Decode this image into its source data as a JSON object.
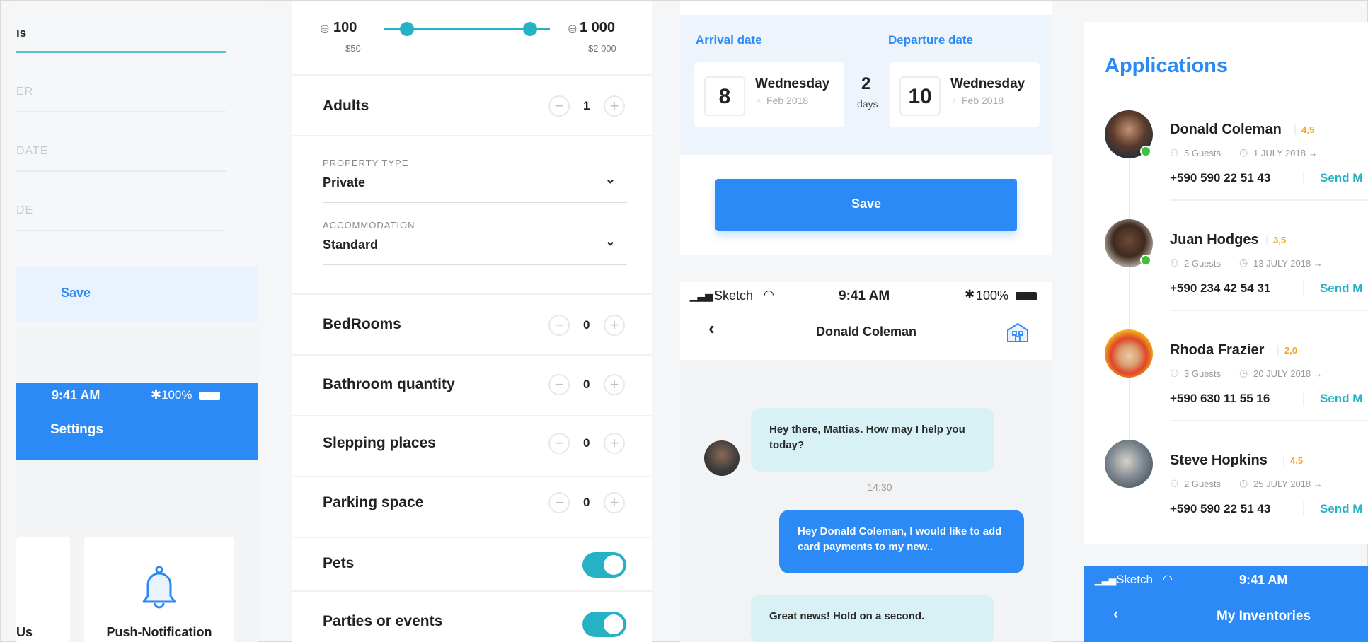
{
  "colors": {
    "accent": "#2b8af5",
    "teal": "#26b1c4",
    "online": "#3bc13b",
    "rating": "#f5a623"
  },
  "left": {
    "top_field_value": "ıs",
    "placeholders": [
      "ER",
      "DATE",
      "DE"
    ],
    "save_label": "Save",
    "status_time": "9:41 AM",
    "status_battery": "100%",
    "header_title": "Settings",
    "tile1_label": "Us",
    "tile2_label": "Push-Notification"
  },
  "filters": {
    "price_min": "100",
    "price_max": "1 000",
    "price_min_sub": "$50",
    "price_max_sub": "$2 000",
    "adults": {
      "label": "Adults",
      "value": "1"
    },
    "property_type": {
      "label": "PROPERTY TYPE",
      "value": "Private"
    },
    "accommodation": {
      "label": "ACCOMMODATION",
      "value": "Standard"
    },
    "counters": [
      {
        "label": "BedRooms",
        "value": "0"
      },
      {
        "label": "Bathroom quantity",
        "value": "0"
      },
      {
        "label": "Slepping places",
        "value": "0"
      },
      {
        "label": "Parking space",
        "value": "0"
      }
    ],
    "toggles": [
      {
        "label": "Pets",
        "on": true
      },
      {
        "label": "Parties or events",
        "on": true
      }
    ]
  },
  "booking": {
    "arrival_label": "Arrival date",
    "departure_label": "Departure date",
    "arrival_day": "8",
    "arrival_weekday": "Wednesday",
    "arrival_month": "Feb 2018",
    "nights": "2",
    "nights_label": "days",
    "departure_day": "10",
    "departure_weekday": "Wednesday",
    "departure_month": "Feb 2018",
    "save_label": "Save"
  },
  "chat": {
    "carrier": "Sketch",
    "time": "9:41 AM",
    "battery": "100%",
    "back": "‹",
    "title": "Donald Coleman",
    "messages": [
      {
        "text": "Hey there, Mattias. How may I help you today?",
        "side": "in"
      },
      {
        "text": "Hey Donald Coleman, I would like to add card payments to my new..",
        "side": "out"
      },
      {
        "text": "Great news! Hold on a second.",
        "side": "in"
      }
    ],
    "timestamp": "14:30"
  },
  "applications": {
    "title": "Applications",
    "items": [
      {
        "name": "Donald Coleman",
        "rating": "4,5",
        "guests": "5 Guests",
        "date": "1 JULY 2018 →",
        "phone": "+590 590 22 51 43",
        "action": "Send M",
        "online": true
      },
      {
        "name": "Juan Hodges",
        "rating": "3,5",
        "guests": "2 Guests",
        "date": "13 JULY 2018 →",
        "phone": "+590 234 42 54 31",
        "action": "Send M",
        "online": true
      },
      {
        "name": "Rhoda Frazier",
        "rating": "2,0",
        "guests": "3 Guests",
        "date": "20 JULY 2018 →",
        "phone": "+590 630 11 55 16",
        "action": "Send M",
        "online": false
      },
      {
        "name": "Steve Hopkins",
        "rating": "4,5",
        "guests": "2 Guests",
        "date": "25 JULY 2018 →",
        "phone": "+590 590 22 51 43",
        "action": "Send M",
        "online": false
      }
    ],
    "status_carrier": "Sketch",
    "status_time": "9:41 AM",
    "header_back": "‹",
    "header_title": "My Inventories"
  }
}
